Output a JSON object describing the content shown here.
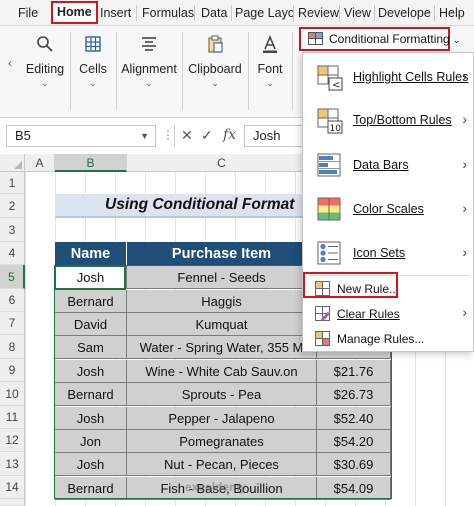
{
  "ribbon_tabs": [
    "File",
    "Home",
    "Insert",
    "Formulas",
    "Data",
    "Page Layc",
    "Review",
    "View",
    "Develope",
    "Help"
  ],
  "ribbon_groups": [
    {
      "label": "Editing",
      "icon": "search-icon"
    },
    {
      "label": "Cells",
      "icon": "cells-icon"
    },
    {
      "label": "Alignment",
      "icon": "align-icon"
    },
    {
      "label": "Clipboard",
      "icon": "clipboard-icon"
    },
    {
      "label": "Font",
      "icon": "font-icon"
    }
  ],
  "formula_bar": {
    "name_box": "B5",
    "fx_label": "fx",
    "value": "Josh"
  },
  "columns": [
    "A",
    "B",
    "C"
  ],
  "rows": [
    "1",
    "2",
    "3",
    "4",
    "5",
    "6",
    "7",
    "8",
    "9",
    "10",
    "11",
    "12",
    "13",
    "14"
  ],
  "sheet": {
    "title": "Using Conditional Format",
    "headers": [
      "Name",
      "Purchase Item",
      ""
    ],
    "rows": [
      {
        "name": "Josh",
        "item": "Fennel - Seeds",
        "price": ""
      },
      {
        "name": "Bernard",
        "item": "Haggis",
        "price": ""
      },
      {
        "name": "David",
        "item": "Kumquat",
        "price": ""
      },
      {
        "name": "Sam",
        "item": "Water - Spring Water, 355 M",
        "price": ""
      },
      {
        "name": "Josh",
        "item": "Wine - White Cab Sauv.on",
        "price": "$21.76"
      },
      {
        "name": "Bernard",
        "item": "Sprouts - Pea",
        "price": "$26.73"
      },
      {
        "name": "Josh",
        "item": "Pepper - Jalapeno",
        "price": "$52.40"
      },
      {
        "name": "Jon",
        "item": "Pomegranates",
        "price": "$54.20"
      },
      {
        "name": "Josh",
        "item": "Nut - Pecan, Pieces",
        "price": "$30.69"
      },
      {
        "name": "Bernard",
        "item": "Fish - Base, Bouillion",
        "price": "$54.09"
      }
    ],
    "watermark": "exceldemy"
  },
  "conditional_formatting": {
    "button_label": "Conditional Formatting",
    "menu_items": [
      {
        "label": "Highlight Cells Rules",
        "icon": "highlight-cells-icon",
        "has_submenu": true
      },
      {
        "label": "Top/Bottom Rules",
        "icon": "top-bottom-icon",
        "has_submenu": true
      },
      {
        "label": "Data Bars",
        "icon": "data-bars-icon",
        "has_submenu": true
      },
      {
        "label": "Color Scales",
        "icon": "color-scales-icon",
        "has_submenu": true
      },
      {
        "label": "Icon Sets",
        "icon": "icon-sets-icon",
        "has_submenu": true
      },
      {
        "label": "New Rule...",
        "icon": "new-rule-icon",
        "has_submenu": false
      },
      {
        "label": "Clear Rules",
        "icon": "clear-rules-icon",
        "has_submenu": true
      },
      {
        "label": "Manage Rules...",
        "icon": "manage-rules-icon",
        "has_submenu": false
      }
    ]
  },
  "colors": {
    "accent_green": "#217346",
    "header_blue": "#1f4e79",
    "highlight_red": "#d8121b",
    "cell_gray": "#d0d0d0"
  }
}
